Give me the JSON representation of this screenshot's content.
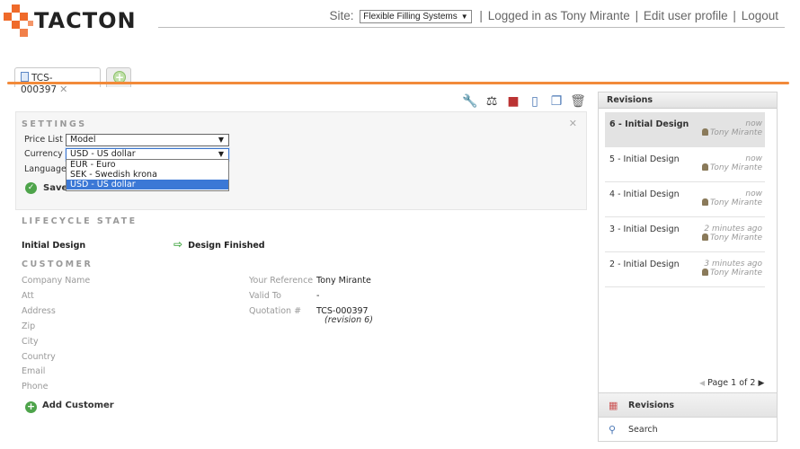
{
  "brand": {
    "name": "TACTON",
    "accent_color": "#ef6a2a"
  },
  "topbar": {
    "site_label": "Site:",
    "site_value": "Flexible Filling Systems",
    "logged_in_text": "Logged in as Tony Mirante",
    "edit_profile": "Edit user profile",
    "logout": "Logout"
  },
  "tabs": [
    {
      "label": "TCS-000397",
      "closable": true
    },
    {
      "label": "",
      "icon": "plus-icon"
    }
  ],
  "toolbar": {
    "icons": [
      "wrench-icon",
      "scale-icon",
      "package-icon",
      "document-icon",
      "copy-icon",
      "trash-icon"
    ]
  },
  "settings": {
    "title": "SETTINGS",
    "price_list_label": "Price List",
    "price_list_value": "Model",
    "currency_label": "Currency",
    "currency_value": "USD - US dollar",
    "language_label": "Language",
    "currency_options": [
      "EUR - Euro",
      "SEK - Swedish krona",
      "USD - US dollar"
    ],
    "save_label": "Save"
  },
  "lifecycle": {
    "title": "LIFECYCLE STATE",
    "state": "Initial Design",
    "transition": "Design Finished"
  },
  "customer": {
    "title": "CUSTOMER",
    "fields": [
      "Company Name",
      "Att",
      "Address",
      "Zip",
      "City",
      "Country",
      "Email",
      "Phone"
    ],
    "reference_label": "Your Reference",
    "reference_value": "Tony Mirante",
    "valid_to_label": "Valid To",
    "valid_to_value": "-",
    "quotation_label": "Quotation #",
    "quotation_value": "TCS-000397",
    "quotation_revision": "(revision 6)",
    "add_label": "Add Customer"
  },
  "revisions": {
    "title": "Revisions",
    "items": [
      {
        "name": "6 - Initial Design",
        "time": "now",
        "user": "Tony Mirante",
        "active": true
      },
      {
        "name": "5 - Initial Design",
        "time": "now",
        "user": "Tony Mirante"
      },
      {
        "name": "4 - Initial Design",
        "time": "now",
        "user": "Tony Mirante"
      },
      {
        "name": "3 - Initial Design",
        "time": "2 minutes ago",
        "user": "Tony Mirante"
      },
      {
        "name": "2 - Initial Design",
        "time": "3 minutes ago",
        "user": "Tony Mirante"
      }
    ],
    "pager": "Page 1 of 2",
    "accordion": [
      "Revisions",
      "Search"
    ]
  }
}
